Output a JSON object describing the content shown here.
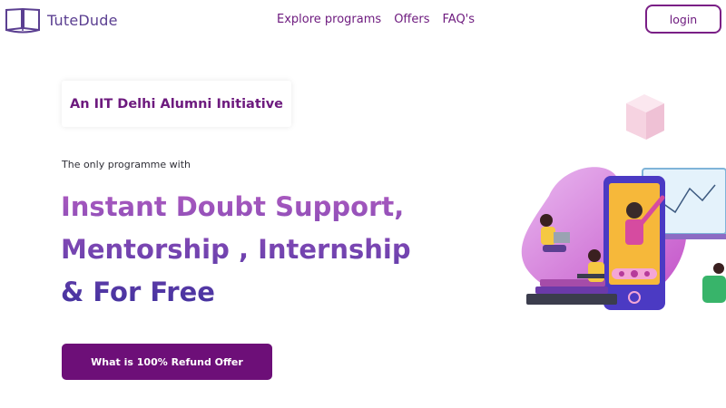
{
  "header": {
    "brand": "TuteDude",
    "nav": {
      "explore": "Explore programs",
      "offers": "Offers",
      "faqs": "FAQ's"
    },
    "login_label": "login"
  },
  "hero": {
    "badge": "An IIT Delhi Alumni Initiative",
    "subtitle": "The only programme with",
    "headline": {
      "line1": "Instant Doubt Support,",
      "line2": "Mentorship , Internship",
      "line3": "& For Free"
    },
    "cta_label": "What is 100% Refund Offer"
  },
  "colors": {
    "brand_purple": "#6d0f78",
    "headline_gradient_top": "#b15cc1",
    "headline_gradient_bottom": "#3c2f9c"
  },
  "illustration": {
    "name": "online-learning-illustration"
  }
}
